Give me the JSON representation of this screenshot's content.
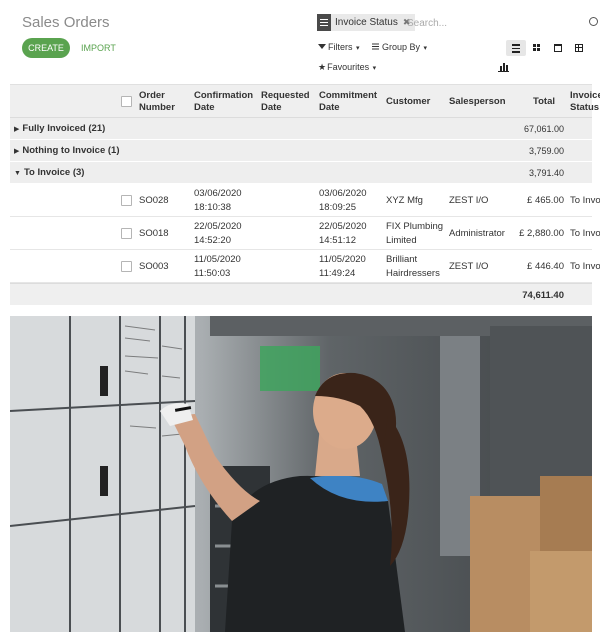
{
  "page": {
    "title": "Sales Orders"
  },
  "actions": {
    "create_label": "CREATE",
    "import_label": "IMPORT"
  },
  "search": {
    "facet_label": "Invoice Status",
    "facet_close": "✖",
    "placeholder": "Search..."
  },
  "toolbar": {
    "filters_label": "Filters",
    "group_by_label": "Group By",
    "favourites_label": "Favourites",
    "caret": "▾"
  },
  "views": [
    {
      "icon": "list-view-icon",
      "active": true
    },
    {
      "icon": "kanban-view-icon",
      "active": false
    },
    {
      "icon": "calendar-view-icon",
      "active": false
    },
    {
      "icon": "pivot-view-icon",
      "active": false
    },
    {
      "icon": "graph-view-icon",
      "active": false
    }
  ],
  "table": {
    "headers": {
      "order_number": "Order Number",
      "confirmation_date": "Confirmation Date",
      "requested_date": "Requested Date",
      "commitment_date": "Commitment Date",
      "customer": "Customer",
      "salesperson": "Salesperson",
      "total": "Total",
      "invoice_status": "Invoice Status"
    },
    "groups": [
      {
        "label": "Fully Invoiced (21)",
        "arrow": "▶",
        "total": "67,061.00"
      },
      {
        "label": "Nothing to Invoice (1)",
        "arrow": "▶",
        "total": "3,759.00"
      },
      {
        "label": "To Invoice (3)",
        "arrow": "▼",
        "total": "3,791.40"
      }
    ],
    "rows": [
      {
        "order": "SO028",
        "confirmation": [
          "03/06/2020",
          "18:10:38"
        ],
        "commitment": [
          "03/06/2020",
          "18:09:25"
        ],
        "customer": [
          "XYZ Mfg"
        ],
        "salesperson": "ZEST I/O",
        "total": "£ 465.00",
        "invoice_status": "To Invoice"
      },
      {
        "order": "SO018",
        "confirmation": [
          "22/05/2020",
          "14:52:20"
        ],
        "commitment": [
          "22/05/2020",
          "14:51:12"
        ],
        "customer": [
          "FIX Plumbing",
          "Limited"
        ],
        "salesperson": "Administrator",
        "total": "£ 2,880.00",
        "invoice_status": "To Invoice"
      },
      {
        "order": "SO003",
        "confirmation": [
          "11/05/2020",
          "11:50:03"
        ],
        "commitment": [
          "11/05/2020",
          "11:49:24"
        ],
        "customer": [
          "Brilliant",
          "Hairdressers"
        ],
        "salesperson": "ZEST I/O",
        "total": "£ 446.40",
        "invoice_status": "To Invoice"
      }
    ],
    "grand_total": "74,611.40"
  },
  "colors": {
    "accent": "#5aa34f",
    "header_bg": "#efefef",
    "group_bg": "#eeeeee"
  }
}
